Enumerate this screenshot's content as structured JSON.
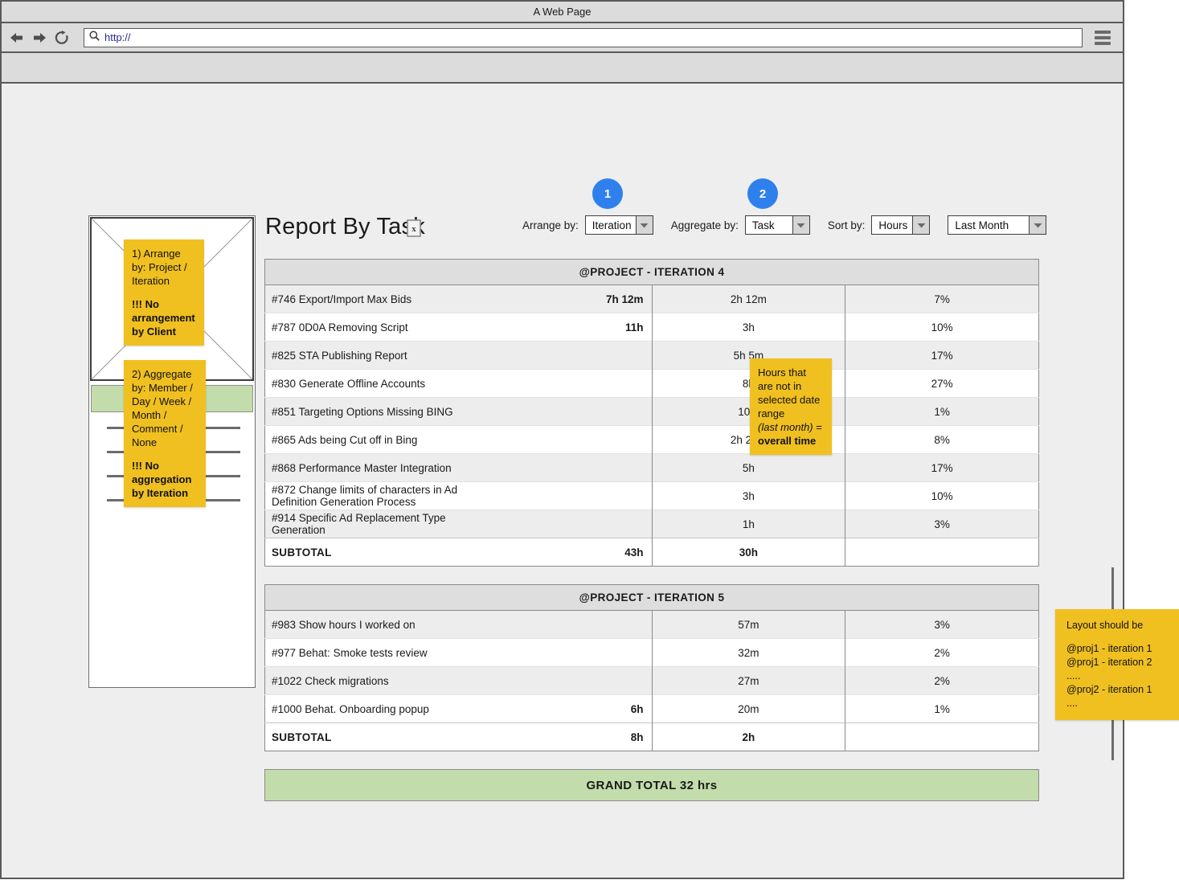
{
  "window": {
    "title": "A Web Page",
    "url_value": "http://",
    "back_icon": "back-arrow-icon",
    "forward_icon": "forward-arrow-icon",
    "reload_icon": "reload-icon",
    "search_icon": "search-icon",
    "menu_icon": "hamburger-menu-icon"
  },
  "page": {
    "title": "Report By Task",
    "export_icon": "excel-export-icon"
  },
  "controls": {
    "arrange_label": "Arrange by:",
    "arrange_value": "Iteration",
    "aggregate_label": "Aggregate by:",
    "aggregate_value": "Task",
    "sort_label": "Sort by:",
    "sort_value": "Hours",
    "range_value": "Last Month",
    "badge_1": "1",
    "badge_2": "2",
    "badge_color": "#2f80ed"
  },
  "notes": {
    "arrange": {
      "line1": "1) Arrange by: Project / Iteration",
      "line2": "!!! No arrangement by Client"
    },
    "aggregate": {
      "line1": "2) Aggregate by: Member / Day / Week / Month / Comment / None",
      "line2": "!!! No aggregation by Iteration"
    },
    "hours": {
      "line1": "Hours that are not in selected date range",
      "line2_italic": "(last month)",
      "line2_tail": " =",
      "line3": "overall time"
    },
    "layout": {
      "heading": "Layout should be",
      "l1": "@proj1 - iteration 1",
      "l2": "@proj1 - iteration 2",
      "l3": ".....",
      "l4": "@proj2 - iteration 1",
      "l5": "...."
    }
  },
  "colors": {
    "note": "#f0c020",
    "green": "#c3dcab",
    "header_gray": "#dedede",
    "stripe": "#ededed"
  },
  "report": {
    "sections": [
      {
        "header": "@PROJECT - ITERATION 4",
        "rows": [
          {
            "task": "#746 Export/Import Max Bids",
            "extra": "7h 12m",
            "hours": "2h 12m",
            "pct": "7%"
          },
          {
            "task": "#787 0D0A Removing Script",
            "extra": "11h",
            "hours": "3h",
            "pct": "10%"
          },
          {
            "task": "#825 STA Publishing Report",
            "extra": "",
            "hours": "5h 5m",
            "pct": "17%"
          },
          {
            "task": "#830 Generate Offline Accounts",
            "extra": "",
            "hours": "8h",
            "pct": "27%"
          },
          {
            "task": "#851 Targeting Options Missing BING",
            "extra": "",
            "hours": "10m",
            "pct": "1%"
          },
          {
            "task": "#865 Ads being Cut off in Bing",
            "extra": "",
            "hours": "2h 20m",
            "pct": "8%"
          },
          {
            "task": "#868 Performance Master Integration",
            "extra": "",
            "hours": "5h",
            "pct": "17%"
          },
          {
            "task": "#872 Change limits of characters in Ad Definition Generation Process",
            "extra": "",
            "hours": "3h",
            "pct": "10%"
          },
          {
            "task": "#914 Specific Ad Replacement Type Generation",
            "extra": "",
            "hours": "1h",
            "pct": "3%"
          }
        ],
        "subtotal": {
          "task": "SUBTOTAL",
          "extra": "43h",
          "hours": "30h",
          "pct": ""
        }
      },
      {
        "header": "@PROJECT - ITERATION 5",
        "rows": [
          {
            "task": "#983 Show hours I worked on",
            "extra": "",
            "hours": "57m",
            "pct": "3%"
          },
          {
            "task": "#977 Behat: Smoke tests review",
            "extra": "",
            "hours": "32m",
            "pct": "2%"
          },
          {
            "task": "#1022 Check migrations",
            "extra": "",
            "hours": "27m",
            "pct": "2%"
          },
          {
            "task": "#1000 Behat. Onboarding popup",
            "extra": "6h",
            "hours": "20m",
            "pct": "1%"
          }
        ],
        "subtotal": {
          "task": "SUBTOTAL",
          "extra": "8h",
          "hours": "2h",
          "pct": ""
        }
      }
    ],
    "grand_total": "GRAND TOTAL 32 hrs"
  }
}
